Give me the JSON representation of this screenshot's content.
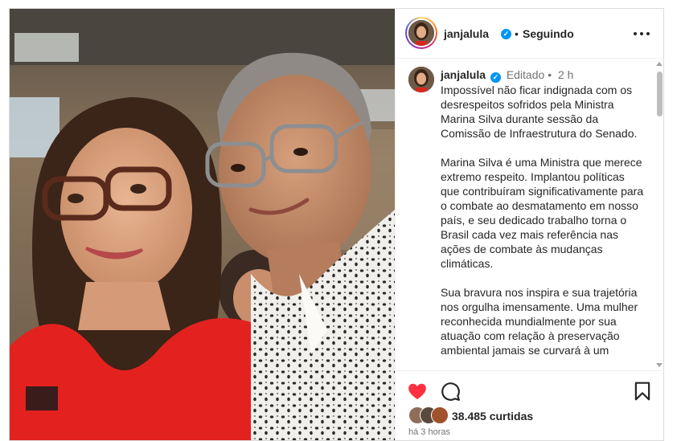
{
  "header": {
    "username": "janjalula",
    "separator": "•",
    "follow_status": "Seguindo"
  },
  "caption": {
    "username": "janjalula",
    "edited_label": "Editado",
    "separator": "•",
    "age": "2 h",
    "text": "Impossível não ficar indignada com os desrespeitos sofridos pela Ministra Marina Silva durante sessão da Comissão de Infraestrutura do Senado.\n\nMarina Silva é uma Ministra que merece extremo respeito. Implantou políticas que contribuíram significativamente para o combate ao desmatamento em nosso país, e seu dedicado trabalho torna o Brasil cada vez mais referência nas ações de combate às mudanças climáticas.\n\nSua bravura nos inspira e sua trajetória nos orgulha imensamente. Uma mulher reconhecida mundialmente por sua atuação com relação à preservação ambiental jamais se curvará à um"
  },
  "engagement": {
    "likes": "38.485 curtidas",
    "timestamp": "há 3 horas"
  },
  "icons": {
    "like": "heart-icon",
    "comment": "comment-icon",
    "save": "bookmark-icon",
    "verified": "verified-badge-icon",
    "more": "more-options-icon"
  },
  "colors": {
    "like_red": "#ff3040",
    "verified_blue": "#0095f6",
    "muted_text": "#737373"
  }
}
